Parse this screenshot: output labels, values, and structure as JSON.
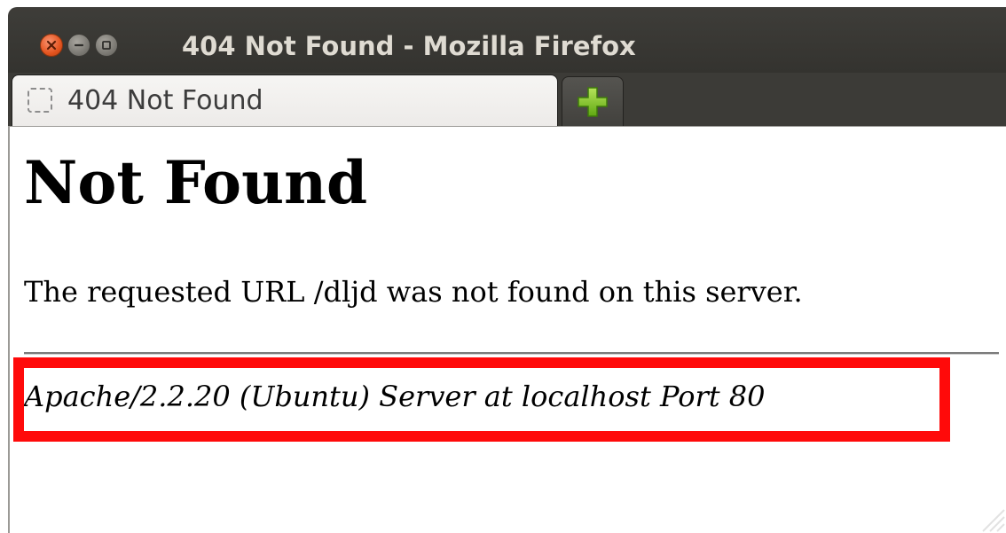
{
  "window": {
    "title": "404 Not Found - Mozilla Firefox",
    "buttons": [
      "close",
      "minimize",
      "maximize"
    ]
  },
  "tabs": [
    {
      "label": "404 Not Found",
      "icon": "blank-page-icon",
      "active": true
    }
  ],
  "new_tab_icon": "plus-icon",
  "page": {
    "heading": "Not Found",
    "message": "The requested URL /dljd was not found on this server.",
    "address": "Apache/2.2.20 (Ubuntu) Server at localhost Port 80"
  },
  "colors": {
    "titlebar": "#3c3b37",
    "close_button": "#e4541f",
    "new_tab_plus": "#7dc021",
    "highlight": "#ff0a0a"
  }
}
